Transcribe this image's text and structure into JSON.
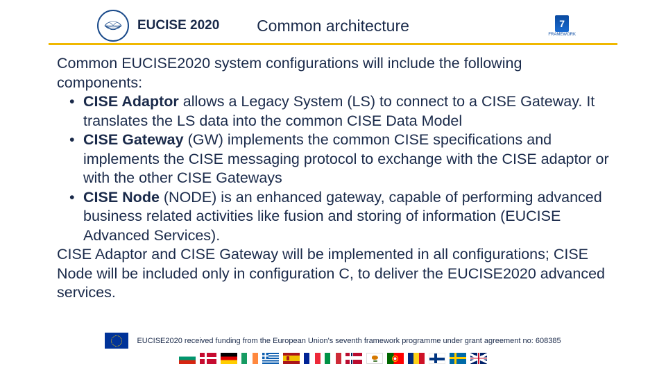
{
  "header": {
    "project_label": "EUCISE 2020",
    "title": "Common architecture",
    "fp_badge_number": "7",
    "fp_badge_caption": "FRAMEWORK"
  },
  "body": {
    "intro": "Common EUCISE2020 system configurations will include the following components:",
    "bullets": [
      {
        "bold": "CISE Adaptor",
        "rest": " allows a Legacy System (LS) to connect to a CISE Gateway. It translates the LS data into the common CISE Data Model"
      },
      {
        "bold": "CISE Gateway",
        "rest": " (GW) implements the common CISE specifications and implements the CISE messaging protocol to exchange with the CISE adaptor or with the other CISE Gateways"
      },
      {
        "bold": "CISE Node",
        "rest": " (NODE) is an enhanced gateway, capable of performing advanced business related activities like fusion and storing of information (EUCISE Advanced Services)."
      }
    ],
    "outro": "CISE Adaptor and CISE Gateway will be implemented in all configurations; CISE Node will be included only in configuration C, to deliver the EUCISE2020 advanced services."
  },
  "footer": {
    "funding_text": "EUCISE2020 received funding from the European Union's seventh framework programme under grant agreement no: 608385",
    "flags": [
      "bg",
      "dk",
      "de",
      "ie",
      "gr",
      "es",
      "fr",
      "it",
      "no",
      "cy",
      "pt",
      "ro",
      "fi",
      "se",
      "uk"
    ]
  }
}
